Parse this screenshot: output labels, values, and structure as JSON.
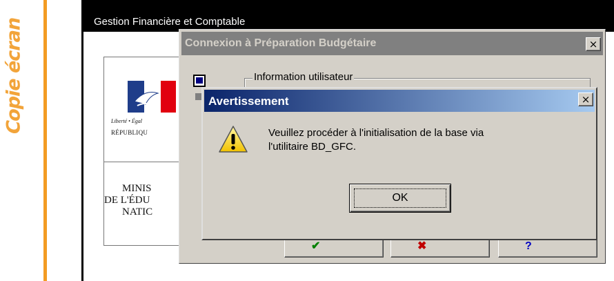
{
  "side_label": "Copie écran",
  "app": {
    "title": "Gestion Financière et Comptable",
    "logo_motto": "Liberté • Égal",
    "logo_country": "RÉPUBLIQU",
    "ministry_lines": [
      "MINIS",
      "DE L'ÉDU",
      "NATIC"
    ]
  },
  "login_dialog": {
    "title": "Connexion à Préparation Budgétaire",
    "close_label": "×",
    "group_label": "Information utilisateur",
    "buttons": [
      {
        "label": "",
        "icon": "check-icon",
        "color": "#008000"
      },
      {
        "label": "",
        "icon": "cross-icon",
        "color": "#c00000"
      },
      {
        "label": "",
        "icon": "help-icon",
        "color": "#0000c0"
      }
    ]
  },
  "warning_dialog": {
    "title": "Avertissement",
    "close_label": "×",
    "message_lines": [
      "Veuillez procéder à l'initialisation de la base via",
      "l'utilitaire BD_GFC."
    ],
    "ok_label": "OK",
    "icon": "warning-icon"
  },
  "colors": {
    "accent_orange": "#f39c23",
    "active_title_start": "#0a246a",
    "active_title_end": "#a6caf0",
    "inactive_title": "#808080",
    "dialog_face": "#d4d0c8"
  }
}
